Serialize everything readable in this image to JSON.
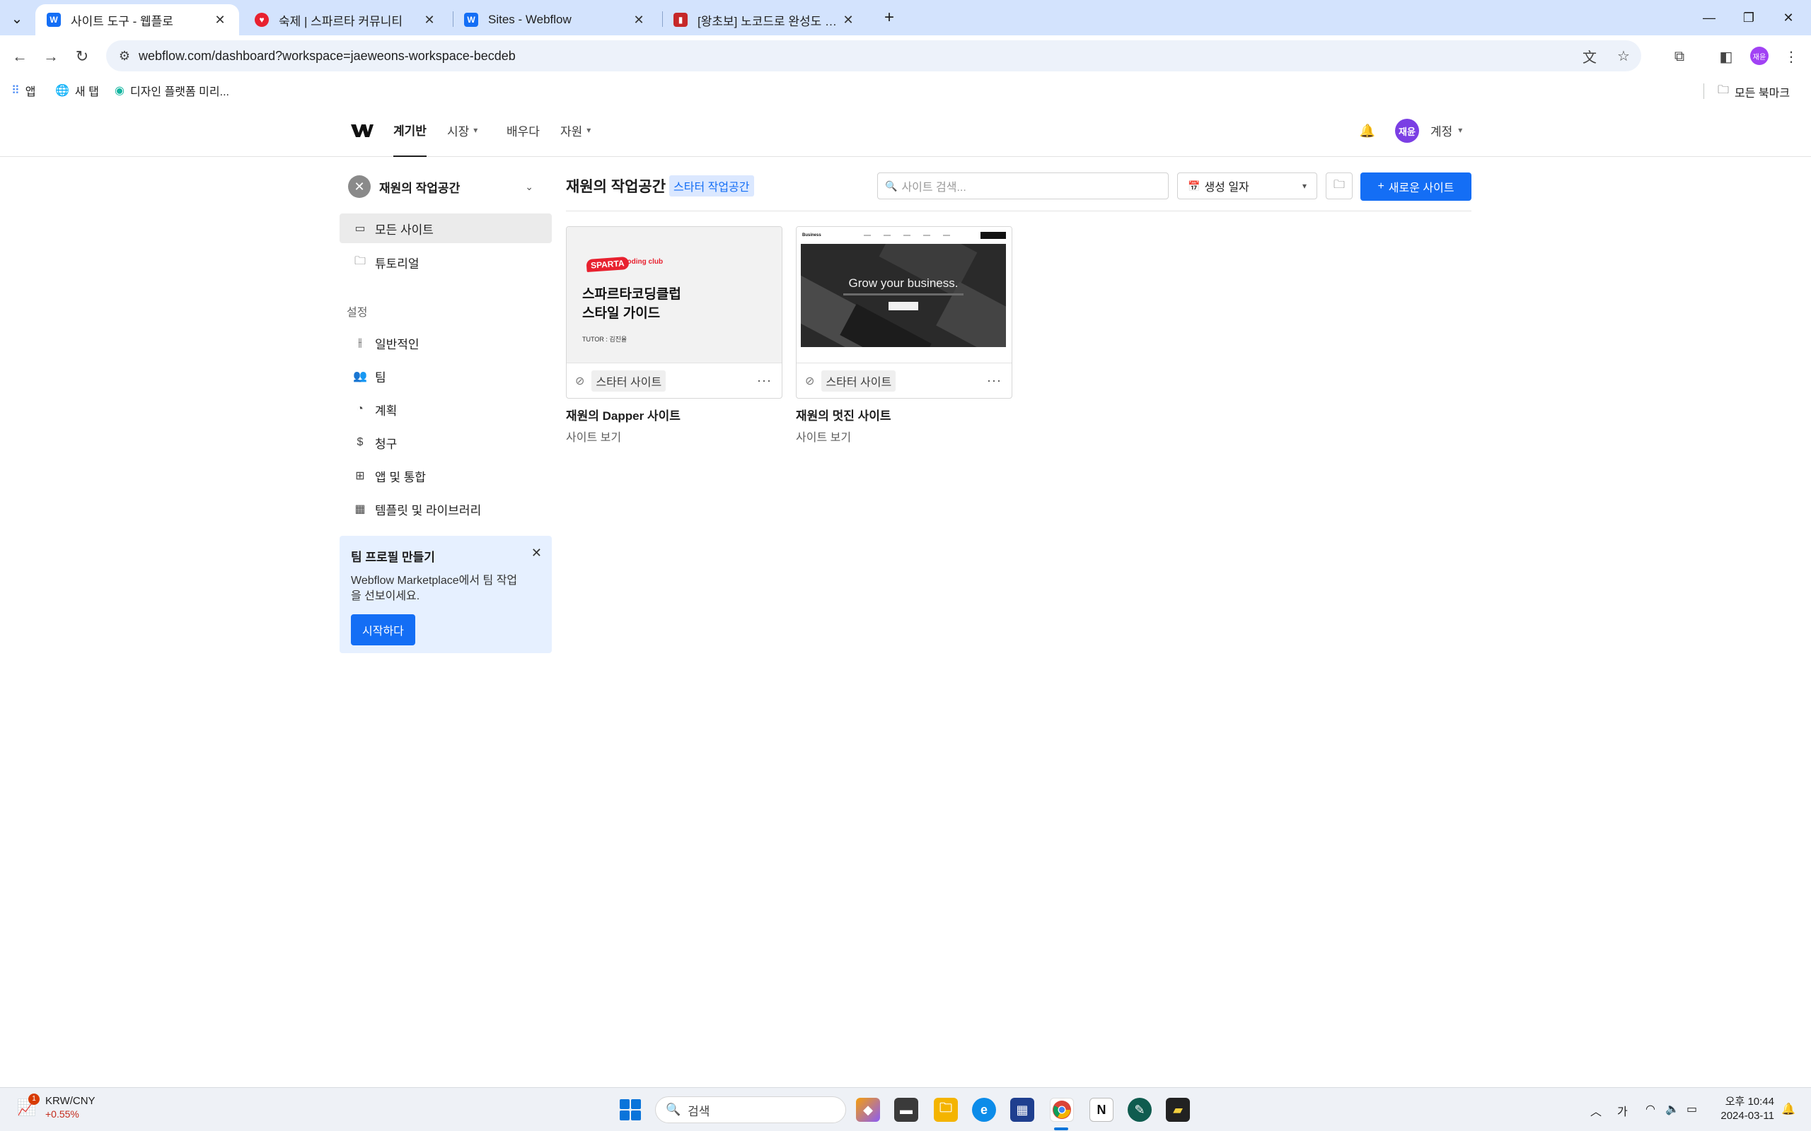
{
  "browser": {
    "tabs": [
      {
        "title": "사이트 도구 - 웹플로",
        "active": true
      },
      {
        "title": "숙제 | 스파르타 커뮤니티",
        "active": false
      },
      {
        "title": "Sites - Webflow",
        "active": false
      },
      {
        "title": "[왕초보] 노코드로 완성도 있는",
        "active": false
      }
    ],
    "url": "webflow.com/dashboard?workspace=jaeweons-workspace-becdeb",
    "profile_initials": "재윤",
    "bookmarks": [
      {
        "label": "앱"
      },
      {
        "label": "새 탭"
      },
      {
        "label": "디자인 플랫폼 미리..."
      }
    ],
    "all_bookmarks": "모든 북마크"
  },
  "app": {
    "nav": {
      "dashboard": "계기반",
      "market": "시장",
      "learn": "배우다",
      "resources": "자원",
      "account": "계정",
      "avatar_initials": "재윤"
    },
    "sidebar": {
      "workspace_name": "재원의 작업공간",
      "items": [
        {
          "label": "모든 사이트"
        },
        {
          "label": "튜토리얼"
        }
      ],
      "settings_heading": "설정",
      "settings_items": [
        {
          "label": "일반적인"
        },
        {
          "label": "팀"
        },
        {
          "label": "계획"
        },
        {
          "label": "청구"
        },
        {
          "label": "앱 및 통합"
        },
        {
          "label": "템플릿 및 라이브러리"
        }
      ],
      "promo": {
        "title": "팀 프로필 만들기",
        "text": "Webflow Marketplace에서 팀 작업을 선보이세요.",
        "button": "시작하다"
      }
    },
    "main": {
      "workspace_title": "재원의 작업공간",
      "plan_badge": "스타터 작업공간",
      "search_placeholder": "사이트 검색...",
      "sort_label": "생성 일자",
      "new_site_label": "새로운 사이트",
      "sites": [
        {
          "name": "재원의 Dapper 사이트",
          "tag": "스타터 사이트",
          "link": "사이트 보기",
          "thumb": {
            "brand": "SPARTA",
            "brand_sub": "coding club",
            "headline_1": "스파르타코딩클럽",
            "headline_2": "스타일 가이드",
            "tutor": "TUTOR : 김진율"
          }
        },
        {
          "name": "재원의 멋진 사이트",
          "tag": "스타터 사이트",
          "link": "사이트 보기",
          "thumb": {
            "logo": "Business",
            "hero_title": "Grow your business."
          }
        }
      ]
    }
  },
  "taskbar": {
    "widget_title": "KRW/CNY",
    "widget_change": "+0.55%",
    "widget_badge": "1",
    "search_label": "검색",
    "ime": "가",
    "time": "오후 10:44",
    "date": "2024-03-11"
  },
  "colors": {
    "accent": "#146ef5",
    "tabbar": "#d3e3fd",
    "promo_bg": "#e6f0ff"
  }
}
